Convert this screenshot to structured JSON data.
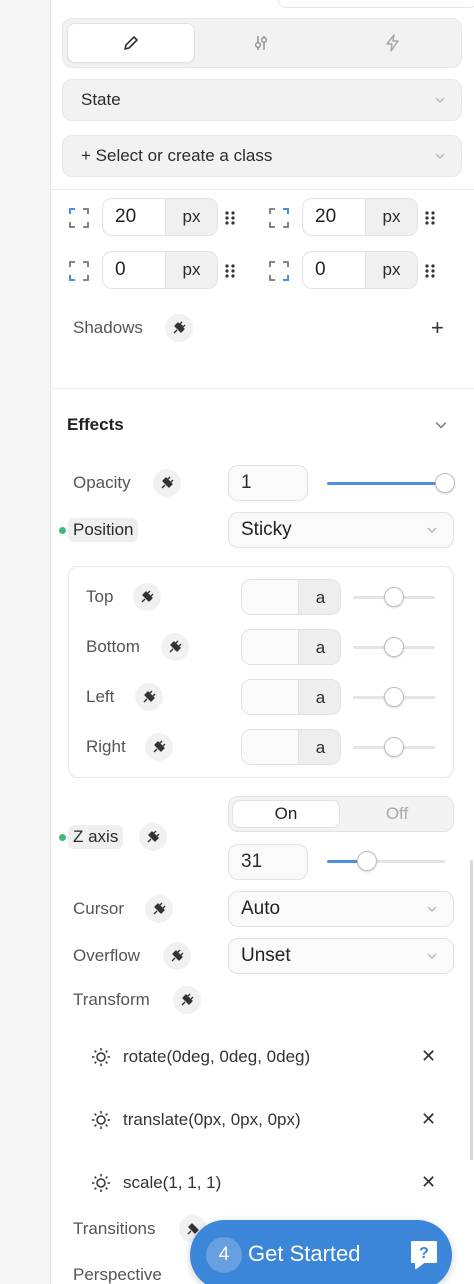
{
  "tabs": {
    "style_icon": "pencil-icon",
    "settings_icon": "sliders-icon",
    "interactions_icon": "lightning-icon"
  },
  "state_dropdown": {
    "label": "State"
  },
  "class_dropdown": {
    "label": "+ Select or create a class"
  },
  "spacing": {
    "top_left": {
      "value": "20",
      "unit": "px"
    },
    "top_right": {
      "value": "20",
      "unit": "px"
    },
    "bottom_left": {
      "value": "0",
      "unit": "px"
    },
    "bottom_right": {
      "value": "0",
      "unit": "px"
    }
  },
  "shadows": {
    "label": "Shadows",
    "add": "+"
  },
  "effects": {
    "title": "Effects"
  },
  "opacity": {
    "label": "Opacity",
    "value": "1",
    "slider_fraction": 1.0
  },
  "position": {
    "label": "Position",
    "value": "Sticky"
  },
  "offsets": [
    {
      "label": "Top",
      "unit": "a",
      "slider_fraction": 0.5
    },
    {
      "label": "Bottom",
      "unit": "a",
      "slider_fraction": 0.5
    },
    {
      "label": "Left",
      "unit": "a",
      "slider_fraction": 0.5
    },
    {
      "label": "Right",
      "unit": "a",
      "slider_fraction": 0.5
    }
  ],
  "z_axis": {
    "label": "Z axis",
    "on": "On",
    "off": "Off",
    "value": "31",
    "slider_fraction": 0.34
  },
  "cursor": {
    "label": "Cursor",
    "value": "Auto"
  },
  "overflow": {
    "label": "Overflow",
    "value": "Unset"
  },
  "transform": {
    "label": "Transform",
    "items": [
      "rotate(0deg, 0deg, 0deg)",
      "translate(0px, 0px, 0px)",
      "scale(1, 1, 1)"
    ]
  },
  "transitions": {
    "label": "Transitions"
  },
  "perspective": {
    "label": "Perspective"
  },
  "cta": {
    "badge": "4",
    "label": "Get Started"
  },
  "colors": {
    "accent": "#4a90e2",
    "cta": "#3b86d9",
    "active_dot": "#3dbb7a"
  }
}
